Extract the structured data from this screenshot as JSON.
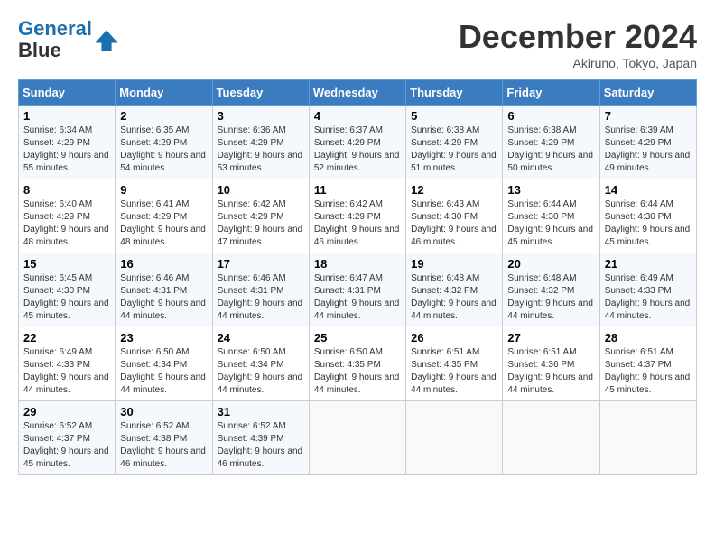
{
  "logo": {
    "line1": "General",
    "line2": "Blue"
  },
  "title": "December 2024",
  "location": "Akiruno, Tokyo, Japan",
  "weekdays": [
    "Sunday",
    "Monday",
    "Tuesday",
    "Wednesday",
    "Thursday",
    "Friday",
    "Saturday"
  ],
  "weeks": [
    [
      {
        "day": "1",
        "sunrise": "Sunrise: 6:34 AM",
        "sunset": "Sunset: 4:29 PM",
        "daylight": "Daylight: 9 hours and 55 minutes."
      },
      {
        "day": "2",
        "sunrise": "Sunrise: 6:35 AM",
        "sunset": "Sunset: 4:29 PM",
        "daylight": "Daylight: 9 hours and 54 minutes."
      },
      {
        "day": "3",
        "sunrise": "Sunrise: 6:36 AM",
        "sunset": "Sunset: 4:29 PM",
        "daylight": "Daylight: 9 hours and 53 minutes."
      },
      {
        "day": "4",
        "sunrise": "Sunrise: 6:37 AM",
        "sunset": "Sunset: 4:29 PM",
        "daylight": "Daylight: 9 hours and 52 minutes."
      },
      {
        "day": "5",
        "sunrise": "Sunrise: 6:38 AM",
        "sunset": "Sunset: 4:29 PM",
        "daylight": "Daylight: 9 hours and 51 minutes."
      },
      {
        "day": "6",
        "sunrise": "Sunrise: 6:38 AM",
        "sunset": "Sunset: 4:29 PM",
        "daylight": "Daylight: 9 hours and 50 minutes."
      },
      {
        "day": "7",
        "sunrise": "Sunrise: 6:39 AM",
        "sunset": "Sunset: 4:29 PM",
        "daylight": "Daylight: 9 hours and 49 minutes."
      }
    ],
    [
      {
        "day": "8",
        "sunrise": "Sunrise: 6:40 AM",
        "sunset": "Sunset: 4:29 PM",
        "daylight": "Daylight: 9 hours and 48 minutes."
      },
      {
        "day": "9",
        "sunrise": "Sunrise: 6:41 AM",
        "sunset": "Sunset: 4:29 PM",
        "daylight": "Daylight: 9 hours and 48 minutes."
      },
      {
        "day": "10",
        "sunrise": "Sunrise: 6:42 AM",
        "sunset": "Sunset: 4:29 PM",
        "daylight": "Daylight: 9 hours and 47 minutes."
      },
      {
        "day": "11",
        "sunrise": "Sunrise: 6:42 AM",
        "sunset": "Sunset: 4:29 PM",
        "daylight": "Daylight: 9 hours and 46 minutes."
      },
      {
        "day": "12",
        "sunrise": "Sunrise: 6:43 AM",
        "sunset": "Sunset: 4:30 PM",
        "daylight": "Daylight: 9 hours and 46 minutes."
      },
      {
        "day": "13",
        "sunrise": "Sunrise: 6:44 AM",
        "sunset": "Sunset: 4:30 PM",
        "daylight": "Daylight: 9 hours and 45 minutes."
      },
      {
        "day": "14",
        "sunrise": "Sunrise: 6:44 AM",
        "sunset": "Sunset: 4:30 PM",
        "daylight": "Daylight: 9 hours and 45 minutes."
      }
    ],
    [
      {
        "day": "15",
        "sunrise": "Sunrise: 6:45 AM",
        "sunset": "Sunset: 4:30 PM",
        "daylight": "Daylight: 9 hours and 45 minutes."
      },
      {
        "day": "16",
        "sunrise": "Sunrise: 6:46 AM",
        "sunset": "Sunset: 4:31 PM",
        "daylight": "Daylight: 9 hours and 44 minutes."
      },
      {
        "day": "17",
        "sunrise": "Sunrise: 6:46 AM",
        "sunset": "Sunset: 4:31 PM",
        "daylight": "Daylight: 9 hours and 44 minutes."
      },
      {
        "day": "18",
        "sunrise": "Sunrise: 6:47 AM",
        "sunset": "Sunset: 4:31 PM",
        "daylight": "Daylight: 9 hours and 44 minutes."
      },
      {
        "day": "19",
        "sunrise": "Sunrise: 6:48 AM",
        "sunset": "Sunset: 4:32 PM",
        "daylight": "Daylight: 9 hours and 44 minutes."
      },
      {
        "day": "20",
        "sunrise": "Sunrise: 6:48 AM",
        "sunset": "Sunset: 4:32 PM",
        "daylight": "Daylight: 9 hours and 44 minutes."
      },
      {
        "day": "21",
        "sunrise": "Sunrise: 6:49 AM",
        "sunset": "Sunset: 4:33 PM",
        "daylight": "Daylight: 9 hours and 44 minutes."
      }
    ],
    [
      {
        "day": "22",
        "sunrise": "Sunrise: 6:49 AM",
        "sunset": "Sunset: 4:33 PM",
        "daylight": "Daylight: 9 hours and 44 minutes."
      },
      {
        "day": "23",
        "sunrise": "Sunrise: 6:50 AM",
        "sunset": "Sunset: 4:34 PM",
        "daylight": "Daylight: 9 hours and 44 minutes."
      },
      {
        "day": "24",
        "sunrise": "Sunrise: 6:50 AM",
        "sunset": "Sunset: 4:34 PM",
        "daylight": "Daylight: 9 hours and 44 minutes."
      },
      {
        "day": "25",
        "sunrise": "Sunrise: 6:50 AM",
        "sunset": "Sunset: 4:35 PM",
        "daylight": "Daylight: 9 hours and 44 minutes."
      },
      {
        "day": "26",
        "sunrise": "Sunrise: 6:51 AM",
        "sunset": "Sunset: 4:35 PM",
        "daylight": "Daylight: 9 hours and 44 minutes."
      },
      {
        "day": "27",
        "sunrise": "Sunrise: 6:51 AM",
        "sunset": "Sunset: 4:36 PM",
        "daylight": "Daylight: 9 hours and 44 minutes."
      },
      {
        "day": "28",
        "sunrise": "Sunrise: 6:51 AM",
        "sunset": "Sunset: 4:37 PM",
        "daylight": "Daylight: 9 hours and 45 minutes."
      }
    ],
    [
      {
        "day": "29",
        "sunrise": "Sunrise: 6:52 AM",
        "sunset": "Sunset: 4:37 PM",
        "daylight": "Daylight: 9 hours and 45 minutes."
      },
      {
        "day": "30",
        "sunrise": "Sunrise: 6:52 AM",
        "sunset": "Sunset: 4:38 PM",
        "daylight": "Daylight: 9 hours and 46 minutes."
      },
      {
        "day": "31",
        "sunrise": "Sunrise: 6:52 AM",
        "sunset": "Sunset: 4:39 PM",
        "daylight": "Daylight: 9 hours and 46 minutes."
      },
      null,
      null,
      null,
      null
    ]
  ]
}
